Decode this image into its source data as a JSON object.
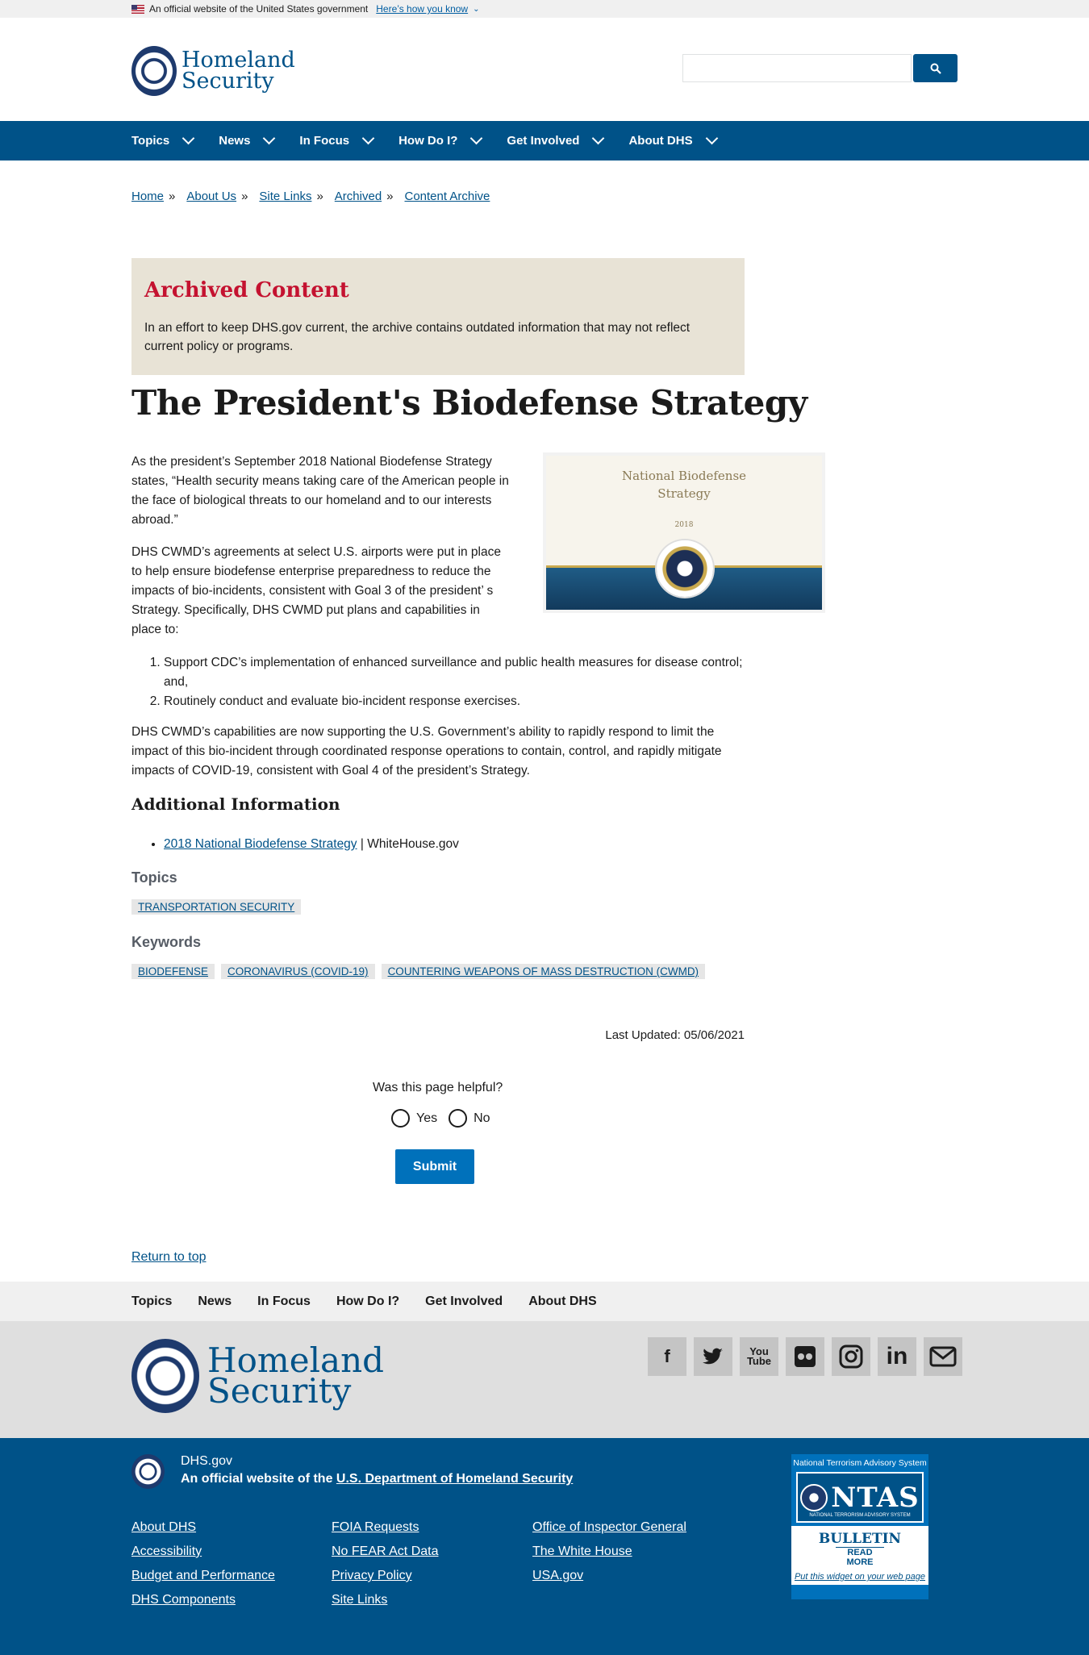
{
  "gov_banner": {
    "text": "An official website of the United States government",
    "link": "Here’s how you know"
  },
  "header": {
    "logo_line1": "Homeland",
    "logo_line2": "Security",
    "search_placeholder": "",
    "search_icon": "search-icon"
  },
  "nav": {
    "items": [
      "Topics",
      "News",
      "In Focus",
      "How Do I?",
      "Get Involved",
      "About DHS"
    ]
  },
  "breadcrumb": [
    "Home",
    "About Us",
    "Site Links",
    "Archived",
    "Content Archive"
  ],
  "archived": {
    "heading": "Archived Content",
    "text": "In an effort to keep DHS.gov current, the archive contains outdated information that may not reflect current policy or programs."
  },
  "page_title": "The President's Biodefense Strategy",
  "image": {
    "title_line1": "National Biodefense",
    "title_line2": "Strategy",
    "year": "2018"
  },
  "content": {
    "p1": "As the president’s September 2018 National Biodefense Strategy states, “Health security means taking care of the American people in the face of biological threats to our homeland and to our interests abroad.”",
    "p2": "DHS CWMD’s agreements at select U.S. airports were put in place to help ensure biodefense enterprise preparedness to reduce the impacts of bio-incidents, consistent with Goal 3 of the president’ s Strategy. Specifically, DHS CWMD put plans and capabilities in place to:",
    "list": [
      "Support CDC’s implementation of enhanced surveillance and public health measures for disease control; and,",
      "Routinely conduct and evaluate bio-incident response exercises."
    ],
    "p3": "DHS CWMD’s capabilities are now supporting the U.S. Government’s ability to rapidly respond to limit the impact of this bio-incident through coordinated response operations to contain, control, and rapidly mitigate impacts of COVID-19, consistent with Goal 4 of the president’s Strategy."
  },
  "additional": {
    "heading": "Additional Information",
    "link": "2018 National Biodefense Strategy",
    "suffix": " | WhiteHouse.gov"
  },
  "topics": {
    "heading": "Topics",
    "tags": [
      "Transportation Security"
    ]
  },
  "keywords": {
    "heading": "Keywords",
    "tags": [
      "Biodefense",
      "Coronavirus (COVID-19)",
      "Countering Weapons of Mass Destruction (CWMD)"
    ]
  },
  "last_updated": "Last Updated: 05/06/2021",
  "feedback": {
    "question": "Was this page helpful?",
    "yes": "Yes",
    "no": "No",
    "submit": "Submit"
  },
  "return_top": "Return to top",
  "footer_nav": [
    "Topics",
    "News",
    "In Focus",
    "How Do I?",
    "Get Involved",
    "About DHS"
  ],
  "footer_logo": {
    "line1": "Homeland",
    "line2": "Security"
  },
  "social": [
    "facebook-icon",
    "twitter-icon",
    "youtube-icon",
    "flickr-icon",
    "instagram-icon",
    "linkedin-icon",
    "email-icon"
  ],
  "footer": {
    "site": "DHS.gov",
    "official_prefix": "An official website of the ",
    "official_link": "U.S. Department of Homeland Security",
    "col1": [
      "About DHS",
      "Accessibility",
      "Budget and Performance",
      "DHS Components"
    ],
    "col2": [
      "FOIA Requests",
      "No FEAR Act Data",
      "Privacy Policy",
      "Site Links"
    ],
    "col3": [
      "Office of Inspector General",
      "The White House",
      "USA.gov"
    ]
  },
  "ntas": {
    "head": "National Terrorism Advisory System",
    "word": "NTAS",
    "sub": "NATIONAL TERRORISM ADVISORY SYSTEM",
    "bulletin": "BULLETIN",
    "read_more": "READ MORE",
    "widget": "Put this widget on your web page"
  },
  "colors": {
    "primary": "#005288",
    "archived_bg": "#e8e3d6",
    "archived_heading": "#c41230",
    "submit": "#0071bb"
  }
}
